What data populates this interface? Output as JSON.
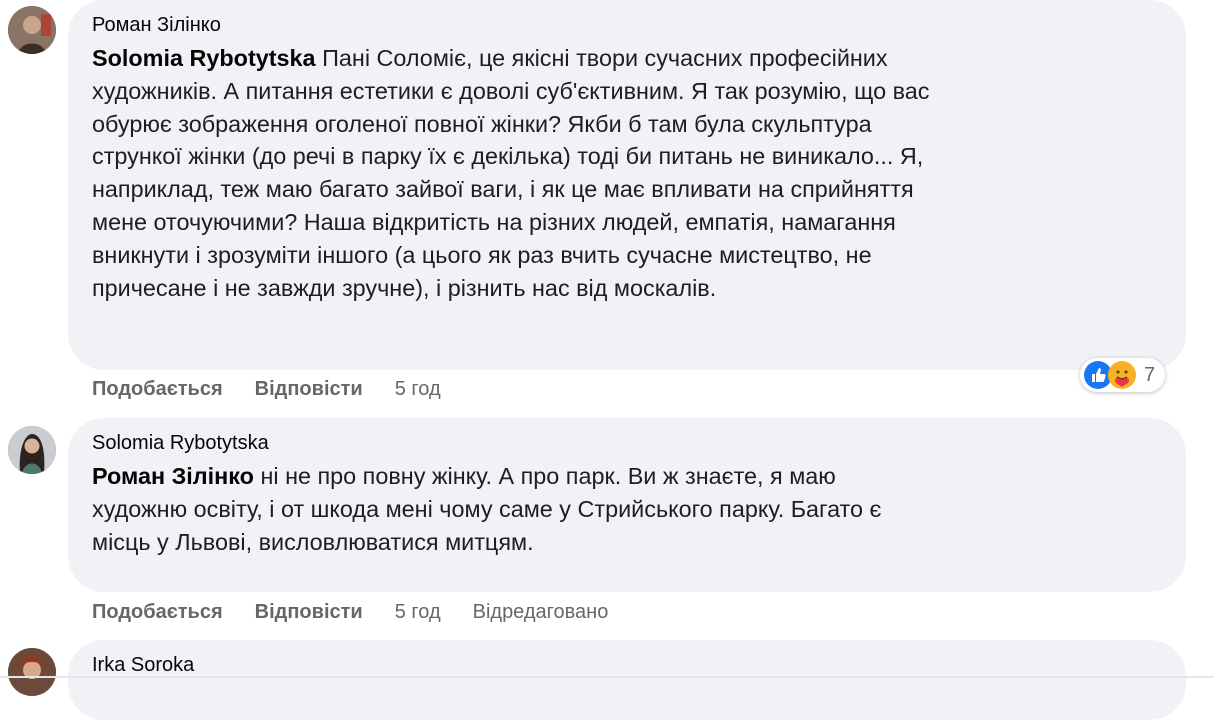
{
  "comments": [
    {
      "author": "Роман Зілінко",
      "mention": "Solomia Rybotytska",
      "lines": [
        " Пані Соломіє, це якісні твори сучасних професійних",
        "художників. А питання естетики є доволі суб'єктивним. Я так розумію, що вас",
        "обурює зображення оголеної повної жінки? Якби б там була скульптура",
        "стрункої жінки (до речі в парку їх є декілька) тоді би питань не виникало... Я,",
        "наприклад, теж маю багато зайвої ваги, і як це має впливати на сприйняття",
        "мене оточуючими? Наша відкритість на різних людей, емпатія, намагання",
        "вникнути і зрозуміти іншого (а цього як раз вчить сучасне мистецтво, не",
        "причесане і не завжди зручне), і різнить нас від москалів."
      ],
      "like_label": "Подобається",
      "reply_label": "Відповісти",
      "time": "5 год",
      "reactions": {
        "icons": [
          "like-icon",
          "care-icon"
        ],
        "count": "7"
      }
    },
    {
      "author": "Solomia Rybotytska",
      "mention": "Роман Зілінко",
      "lines": [
        " ні не про повну жінку. А про парк. Ви ж знаєте, я маю",
        "художню освіту, і от шкода мені чому саме у Стрийського парку. Багато є",
        "місць у Львові, висловлюватися митцям."
      ],
      "like_label": "Подобається",
      "reply_label": "Відповісти",
      "time": "5 год",
      "edited": "Відредаговано"
    },
    {
      "author": "Irka Soroka"
    }
  ],
  "colors": {
    "bubble": "#f0f2f5",
    "meta": "#65676b",
    "like_blue": "#1877f2",
    "care_yellow": "#f7b125"
  }
}
